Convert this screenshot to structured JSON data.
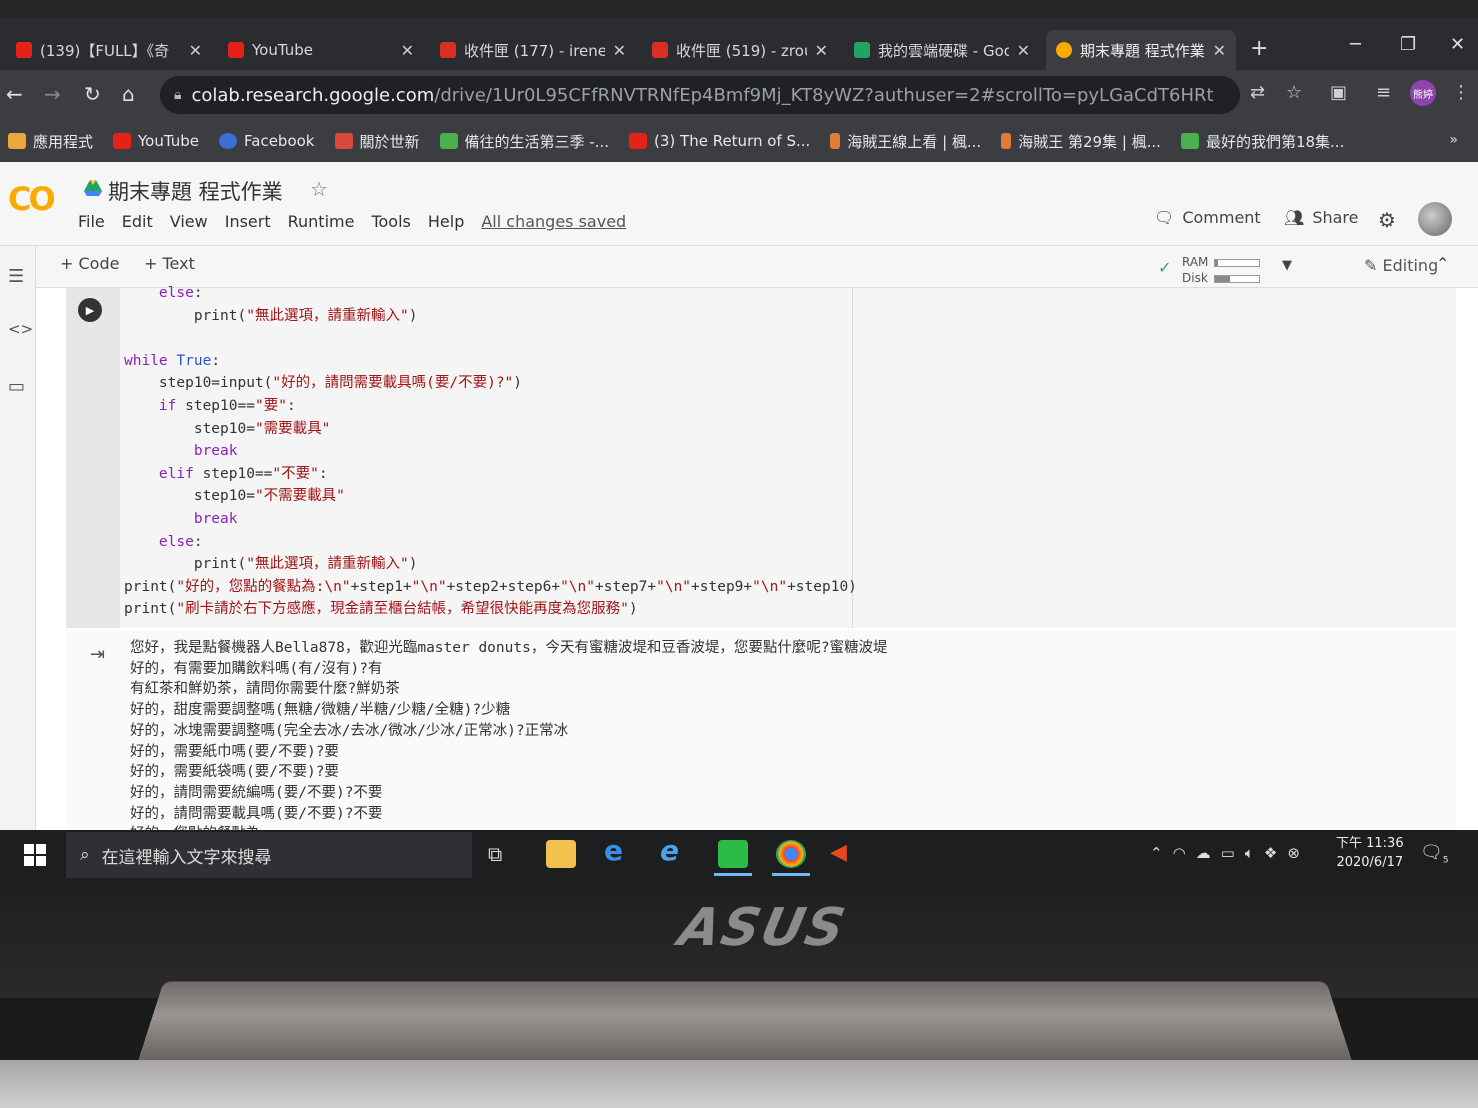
{
  "browser": {
    "tabs": [
      {
        "title": "(139)【FULL】《奇",
        "favicon_color": "#e62117"
      },
      {
        "title": "YouTube",
        "favicon_color": "#e62117"
      },
      {
        "title": "收件匣 (177) - irene",
        "favicon_color": "#d93025"
      },
      {
        "title": "收件匣 (519) - zrou",
        "favicon_color": "#d93025"
      },
      {
        "title": "我的雲端硬碟 - Goo",
        "favicon_color": "#1fa463"
      },
      {
        "title": "期末專題 程式作業",
        "favicon_color": "#f9ab00"
      }
    ],
    "url_host": "colab.research.google.com",
    "url_path": "/drive/1Ur0L95CFfRNVTRNfEp4Bmf9Mj_KT8yWZ?authuser=2#scrollTo=pyLGaCdT6HRt",
    "profile_label": "熊婷",
    "bookmarks": [
      {
        "label": "應用程式",
        "icon": "apps-icon",
        "color": "#e8a93a"
      },
      {
        "label": "YouTube",
        "icon": "youtube-icon",
        "color": "#e62117"
      },
      {
        "label": "Facebook",
        "icon": "facebook-icon",
        "color": "#3b6fd6"
      },
      {
        "label": "關於世新",
        "icon": "shu-icon",
        "color": "#d9483b"
      },
      {
        "label": "備往的生活第三季 -...",
        "icon": "tv-icon",
        "color": "#4caf50"
      },
      {
        "label": "(3) The Return of S...",
        "icon": "youtube-icon",
        "color": "#e62117"
      },
      {
        "label": "海賊王線上看 | 楓...",
        "icon": "flame-icon",
        "color": "#e07b39"
      },
      {
        "label": "海賊王 第29集 | 楓...",
        "icon": "flame-icon",
        "color": "#e07b39"
      },
      {
        "label": "最好的我們第18集...",
        "icon": "tv-icon",
        "color": "#4caf50"
      }
    ]
  },
  "colab": {
    "logo": "CO",
    "title": "期末專題 程式作業",
    "menu": [
      "File",
      "Edit",
      "View",
      "Insert",
      "Runtime",
      "Tools",
      "Help"
    ],
    "saved_status": "All changes saved",
    "comment_label": "Comment",
    "share_label": "Share",
    "add_code": "+ Code",
    "add_text": "+ Text",
    "ram_label": "RAM",
    "disk_label": "Disk",
    "ram_usage": 0.05,
    "disk_usage": 0.35,
    "editing_label": "Editing"
  },
  "code_lines": [
    "    else:",
    "        print(\"無此選項，請重新輸入\")",
    "",
    "while True:",
    "    step10=input(\"好的，請問需要載具嗎(要/不要)?\")",
    "    if step10==\"要\":",
    "        step10=\"需要載具\"",
    "        break",
    "    elif step10==\"不要\":",
    "        step10=\"不需要載具\"",
    "        break",
    "    else:",
    "        print(\"無此選項，請重新輸入\")",
    "print(\"好的，您點的餐點為:\\n\"+step1+\"\\n\"+step2+step6+\"\\n\"+step7+\"\\n\"+step9+\"\\n\"+step10)",
    "print(\"刷卡請於右下方感應，現金請至櫃台結帳，希望很快能再度為您服務\")"
  ],
  "output_lines": [
    "您好，我是點餐機器人Bella878，歡迎光臨master donuts，今天有蜜糖波堤和豆香波堤，您要點什麼呢?蜜糖波堤",
    "好的，有需要加購飲料嗎(有/沒有)?有",
    "有紅茶和鮮奶茶，請問你需要什麼?鮮奶茶",
    "好的，甜度需要調整嗎(無糖/微糖/半糖/少糖/全糖)?少糖",
    "好的，冰塊需要調整嗎(完全去冰/去冰/微冰/少冰/正常冰)?正常冰",
    "好的，需要紙巾嗎(要/不要)?要",
    "好的，需要紙袋嗎(要/不要)?要",
    "好的，請問需要統編嗎(要/不要)?不要",
    "好的，請問需要載具嗎(要/不要)?不要",
    "好的，您點的餐點為:"
  ],
  "taskbar": {
    "search_placeholder": "在這裡輸入文字來搜尋",
    "time": "下午 11:36",
    "date": "2020/6/17",
    "notif_count": "5"
  },
  "laptop_brand": "ASUS"
}
